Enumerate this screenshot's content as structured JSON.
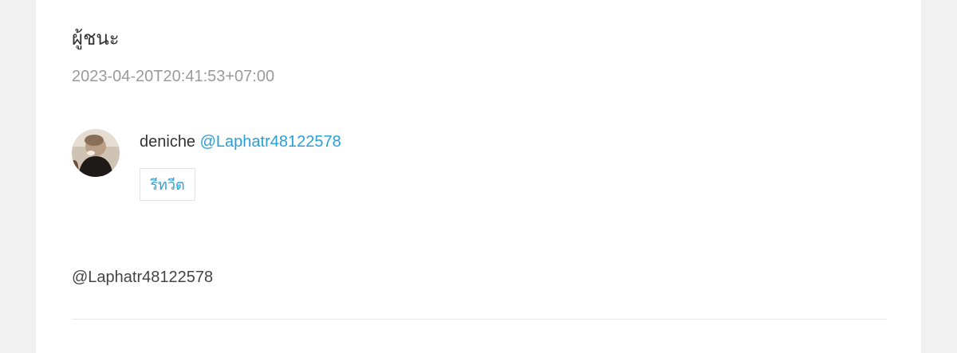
{
  "post": {
    "title": "ผู้ชนะ",
    "timestamp": "2023-04-20T20:41:53+07:00",
    "body": "@Laphatr48122578"
  },
  "author": {
    "name": "deniche",
    "handle": "@Laphatr48122578",
    "avatar_icon": "user-avatar-photo"
  },
  "actions": {
    "retweet_label": "รีทวีต"
  },
  "colors": {
    "link": "#2a9fd8",
    "page_background": "#f1f1f1",
    "card_background": "#ffffff",
    "muted_text": "#9a9a9a"
  }
}
